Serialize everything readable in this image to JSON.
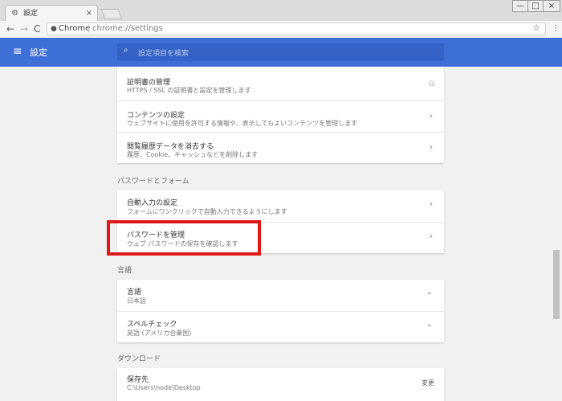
{
  "window": {
    "tab_title": "設定",
    "tab_close": "×",
    "min_glyph": "—",
    "max_glyph": "□",
    "close_glyph": "×"
  },
  "toolbar": {
    "back": "←",
    "forward": "→",
    "reload": "C",
    "site_label": "Chrome",
    "separator": "|",
    "url": "chrome://settings",
    "star": "☆",
    "menu": "⋮"
  },
  "header": {
    "title": "設定",
    "search_placeholder": "設定項目を検索"
  },
  "sections": {
    "privacy_rows": [
      {
        "title": "証明書の管理",
        "subtitle": "HTTPS / SSL の証明書と設定を管理します"
      },
      {
        "title": "コンテンツの設定",
        "subtitle": "ウェブサイトに使用を許可する情報や、表示してもよいコンテンツを管理します"
      },
      {
        "title": "閲覧履歴データを消去する",
        "subtitle": "履歴、Cookie、キャッシュなどを削除します"
      }
    ],
    "passwords_label": "パスワードとフォーム",
    "passwords_rows": [
      {
        "title": "自動入力の設定",
        "subtitle": "フォームにワンクリックで自動入力できるようにします"
      },
      {
        "title": "パスワードを管理",
        "subtitle": "ウェブ パスワードの保存を確認します"
      }
    ],
    "languages_label": "言語",
    "languages_rows": [
      {
        "title": "言語",
        "subtitle": "日本語"
      },
      {
        "title": "スペルチェック",
        "subtitle": "英語 (アメリカ合衆国)"
      }
    ],
    "downloads_label": "ダウンロード",
    "downloads_rows": [
      {
        "title": "保存先",
        "subtitle": "C:\\Users\\node\\Desktop",
        "action": "変更"
      }
    ]
  },
  "icons": {
    "gear": "gear-icon",
    "external": "external-link-icon",
    "chevron_right": "chevron-right-icon",
    "chevron_down": "chevron-down-icon"
  },
  "colors": {
    "header_blue": "#3e6fd6",
    "search_blue": "#3562c4",
    "highlight_red": "#e01818"
  }
}
